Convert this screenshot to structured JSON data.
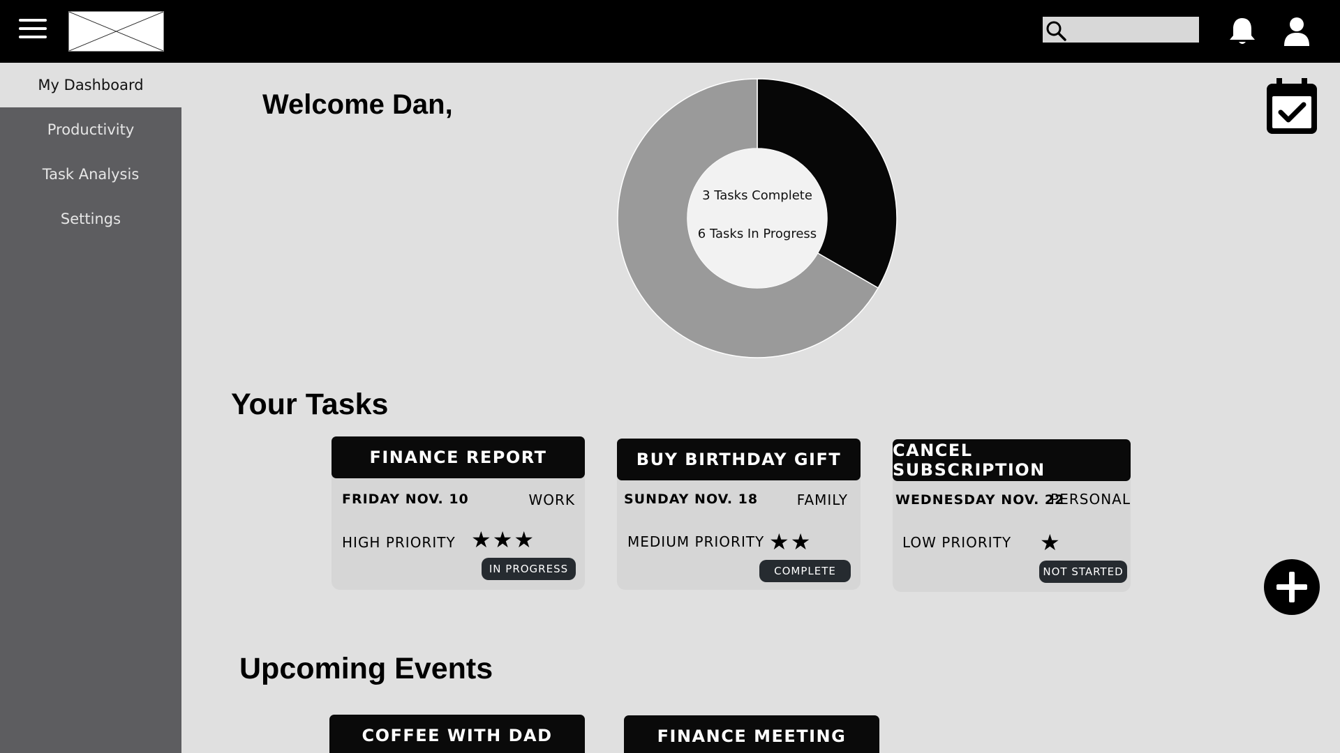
{
  "header": {
    "menu_icon": "hamburger-menu-icon",
    "logo": "placeholder-logo",
    "search": {
      "value": "",
      "placeholder": "",
      "icon": "search-icon"
    },
    "notifications_icon": "bell-icon",
    "profile_icon": "user-icon"
  },
  "sidebar": {
    "items": [
      {
        "label": "My Dashboard",
        "active": true
      },
      {
        "label": "Productivity",
        "active": false
      },
      {
        "label": "Task Analysis",
        "active": false
      },
      {
        "label": "Settings",
        "active": false
      }
    ]
  },
  "main": {
    "welcome": "Welcome Dan,",
    "calendar_icon": "calendar-check-icon",
    "summary": {
      "complete_text": "3 Tasks Complete",
      "in_progress_text": "6 Tasks In Progress"
    },
    "tasks_title": "Your Tasks",
    "tasks": [
      {
        "title": "FINANCE REPORT",
        "date": "FRIDAY NOV. 10",
        "category": "WORK",
        "priority": "HIGH PRIORITY",
        "stars": "★★★",
        "star_count": 3,
        "status": "IN PROGRESS"
      },
      {
        "title": "BUY BIRTHDAY GIFT",
        "date": "SUNDAY NOV. 18",
        "category": "FAMILY",
        "priority": "MEDIUM PRIORITY",
        "stars": "★★",
        "star_count": 2,
        "status": "COMPLETE"
      },
      {
        "title": "CANCEL SUBSCRIPTION",
        "date": "WEDNESDAY NOV. 22",
        "category": "PERSONAL",
        "priority": "LOW PRIORITY",
        "stars": "★",
        "star_count": 1,
        "status": "NOT STARTED"
      }
    ],
    "events_title": "Upcoming Events",
    "events": [
      {
        "title": "COFFEE WITH DAD"
      },
      {
        "title": "FINANCE MEETING"
      }
    ],
    "add_button_icon": "plus-icon"
  },
  "colors": {
    "topbar": "#000000",
    "sidebar": "#5d5d60",
    "background": "#e0e0e0",
    "donut_complete": "#070707",
    "donut_in_progress": "#9a9a9a"
  },
  "chart_data": {
    "type": "pie",
    "categories": [
      "Tasks Complete",
      "Tasks In Progress"
    ],
    "values": [
      3,
      6
    ],
    "title": ""
  }
}
